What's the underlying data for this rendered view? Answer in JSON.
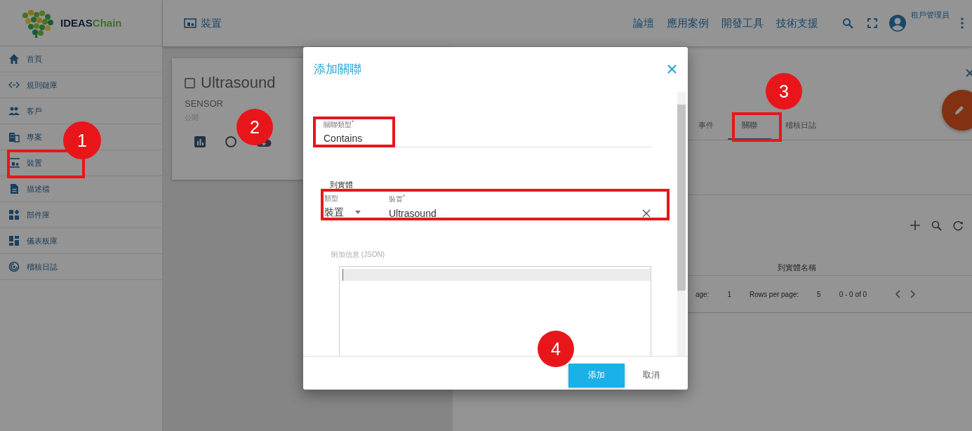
{
  "logo": {
    "name": "IDEAS",
    "suffix": "Chain"
  },
  "sidebar": {
    "items": [
      {
        "label": "首頁"
      },
      {
        "label": "規則鏈庫"
      },
      {
        "label": "客戶"
      },
      {
        "label": "專案"
      },
      {
        "label": "裝置"
      },
      {
        "label": "描述檔"
      },
      {
        "label": "部件庫"
      },
      {
        "label": "儀表板庫"
      },
      {
        "label": "稽核日誌"
      }
    ]
  },
  "header": {
    "title": "裝置",
    "nav": [
      "論壇",
      "應用案例",
      "開發工具",
      "技術支援"
    ],
    "user": "租戶管理員"
  },
  "device_card": {
    "name": "Ultrasound",
    "checked": false,
    "type": "SENSOR",
    "visibility": "公開"
  },
  "details": {
    "tabs": [
      {
        "label": "事件",
        "selected": false
      },
      {
        "label": "關聯",
        "selected": true
      },
      {
        "label": "稽核日誌",
        "selected": false
      }
    ],
    "table": {
      "columns": [
        "到實體名稱"
      ]
    },
    "paginator": {
      "page_label": "age:",
      "page": "1",
      "rows_label": "Rows per page:",
      "rows": "5",
      "range": "0 - 0 of 0"
    }
  },
  "dialog": {
    "title": "添加關聯",
    "relation_type": {
      "label": "關聯類型$^{*}$",
      "value": "Contains"
    },
    "to_entity": {
      "heading": "到實體",
      "type": {
        "label": "類型",
        "value": "裝置"
      },
      "entity": {
        "label": "裝置$^{*}$",
        "value": "Ultrasound"
      }
    },
    "additional_info": {
      "label": "附加信息 (JSON)"
    },
    "buttons": [
      {
        "label": "添加",
        "kind": "primary"
      },
      {
        "label": "取消",
        "kind": "text"
      }
    ]
  },
  "annotations": [
    {
      "kind": "frame"
    },
    {
      "kind": "step",
      "label": "1"
    },
    {
      "kind": "step",
      "label": "2"
    },
    {
      "kind": "frame"
    },
    {
      "kind": "step",
      "label": "3"
    },
    {
      "kind": "frame"
    },
    {
      "kind": "frame"
    },
    {
      "kind": "step",
      "label": "4"
    }
  ]
}
